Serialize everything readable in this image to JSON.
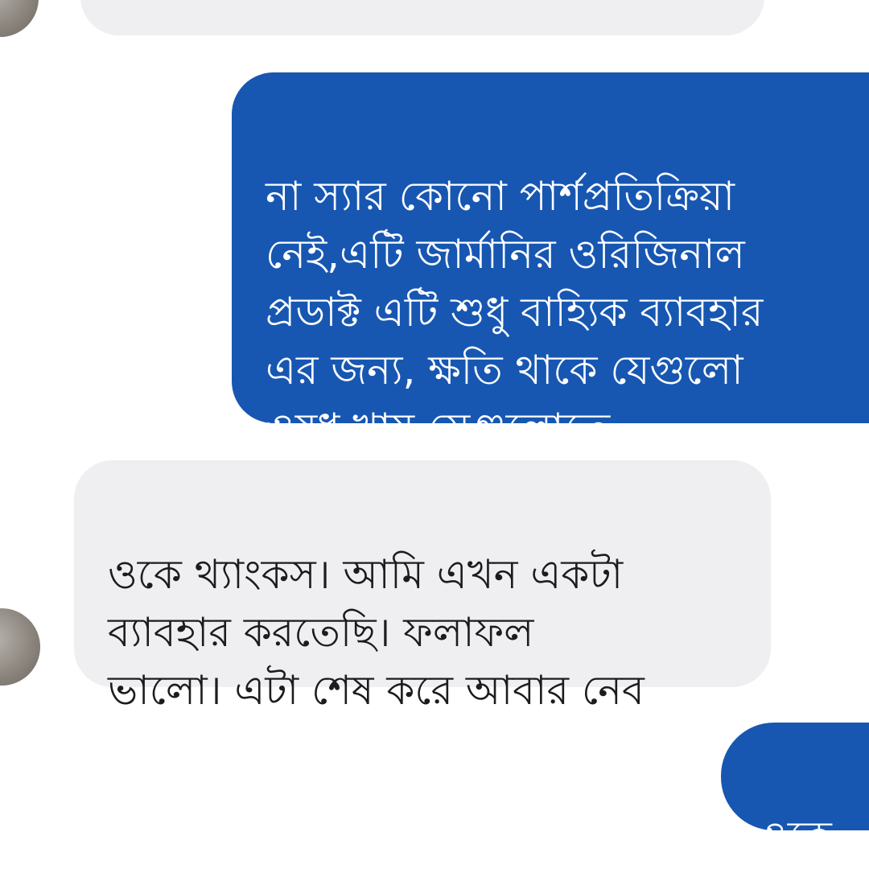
{
  "messages": [
    {
      "direction": "incoming",
      "text": "",
      "note": ""
    },
    {
      "direction": "outgoing",
      "text": "না স্যার কোনো পার্শপ্রতিক্রিয়া\nনেই,এটি জার্মানির ওরিজিনাল\nপ্রডাক্ট এটি শুধু বাহ্যিক ব্যাবহার\nএর জন্য, ক্ষতি থাকে যেগুলো\nওষুধ খায় সেগুলোতে"
    },
    {
      "direction": "incoming",
      "text": "ওকে থ্যাংকস। আমি এখন একটা\nব্যাবহার করতেছি। ফলাফল\nভালো। এটা শেষ করে আবার নেব"
    },
    {
      "direction": "outgoing",
      "text": "ওকে"
    }
  ],
  "colors": {
    "outgoing_bubble": "#1757b2",
    "incoming_bubble": "#efeff1",
    "background": "#ffffff"
  },
  "icons": {
    "sender_avatar": "avatar"
  }
}
